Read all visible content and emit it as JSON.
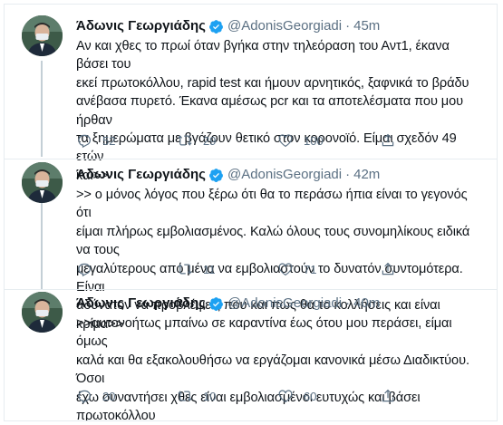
{
  "tweets": [
    {
      "name": "Άδωνις Γεωργιάδης",
      "handle": "@AdonisGeorgiadi",
      "dot": "·",
      "time": "45m",
      "text": "Αν και χθες το πρωί όταν βγήκα στην τηλεόραση του Αντ1, έκανα βάσει του\nεκεί πρωτοκόλλου, rapid test και ήμουν αρνητικός, ξαφνικά το βράδυ\nανέβασα πυρετό. Έκανα αμέσως pcr και τα αποτελέσματα που μου ήρθαν\nτα ξημερώματα με βγάζουν θετικό στον κορονοϊό. Είμαι σχεδόν 49 ετών\nκαι>>",
      "replies": "52",
      "retweets": "29",
      "likes": "100"
    },
    {
      "name": "Άδωνις Γεωργιάδης",
      "handle": "@AdonisGeorgiadi",
      "dot": "·",
      "time": "42m",
      "text": ">> ο μόνος λόγος που ξέρω ότι θα το περάσω ήπια είναι το γεγονός ότι\nείμαι πλήρως εμβολιασμένος. Καλώ όλους τους συνομηλίκους ειδικά να τους\nμεγαλύτερους από μένα να εμβολιαστούν το δυνατόν συντομότερα. Είναι\nαδύνατον να προβλέψεις που και πως θα το κολλήσεις και είναι κρίμα>>",
      "replies": "",
      "retweets": "11",
      "likes": "71"
    },
    {
      "name": "Άδωνις Γεωργιάδης",
      "handle": "@AdonisGeorgiadi",
      "dot": "·",
      "time": "40m",
      "text": ">>αυτονοήτως μπαίνω σε καραντίνα έως ότου μου περάσει, είμαι όμως\nκαλά και θα εξακολουθήσω να εργάζομαι κανονικά μέσω Διαδικτύου. Όσοι\nέχω συναντήσει χθες είναι εμβολιασμένοι ευτυχώς και βάσει πρωτοκόλλου\nδεν μπαίνουν σε καραντίνα, όποτε το γραφείο μου λειτουργεί κανονικά.",
      "replies": "20",
      "retweets": "10",
      "likes": "60"
    }
  ],
  "icons": {
    "reply": "reply-icon",
    "retweet": "retweet-icon",
    "like": "heart-icon",
    "share": "share-icon",
    "verified": "verified-badge-icon"
  },
  "colors": {
    "text": "#0f1419",
    "secondary": "#5b7083",
    "verified": "#1da1f2",
    "divider": "#e6ecf0"
  }
}
